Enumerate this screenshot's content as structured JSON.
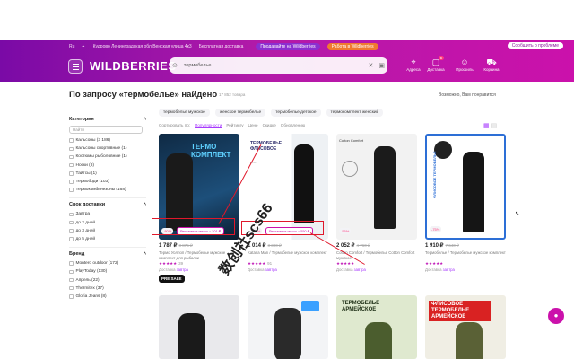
{
  "topbar": {
    "city": "Ru",
    "address": "Кудрово Ленинградская обл Венская улица 4к3",
    "free_delivery": "Бесплатная доставка",
    "sell_link": "Продавайте на Wildberries",
    "work_link": "Работа в Wildberries",
    "support": "Сообщить о проблеме"
  },
  "header": {
    "logo": "WILDBERRIES",
    "search_value": "термобелье",
    "nav": [
      {
        "label": "Адреса",
        "icon": "location-icon"
      },
      {
        "label": "Доставка",
        "icon": "box-icon",
        "badge": "6"
      },
      {
        "label": "Профиль",
        "icon": "user-icon"
      },
      {
        "label": "Корзина",
        "icon": "cart-icon"
      }
    ]
  },
  "page": {
    "title": "По запросу «термобелье» найдено",
    "count": "17 852 товара",
    "maybe_like": "Возможно, Вам понравится"
  },
  "chips": [
    "термобелье мужское",
    "женское термобелье",
    "термобелье детское",
    "термокомплект женский"
  ],
  "sort": {
    "options": [
      "Популярности",
      "Рейтингу",
      "Цене",
      "Скидке",
      "Обновлению"
    ],
    "label": "Сортировать по:"
  },
  "sidebar": {
    "category_title": "Категория",
    "search_placeholder": "Найти",
    "categories": [
      "Кальсоны (3 186)",
      "Кальсоны спортивные (1)",
      "Костюмы рыболовные (1)",
      "Носки (8)",
      "Тайтсы (1)",
      "Термободи (103)",
      "Термокомбинезоны (168)"
    ],
    "delivery_title": "Срок доставки",
    "delivery": [
      "Завтра",
      "до 2 дней",
      "до 3 дней",
      "до 5 дней"
    ],
    "brand_title": "Бренд",
    "brands": [
      "Montero outdoor (172)",
      "PlayToday (130)",
      "Апрель (22)",
      "Thermitex (37)",
      "Gloria Jeans (8)"
    ]
  },
  "products": [
    {
      "price": "1 787 ₽",
      "old": "8 875 ₽",
      "name": "Термо Уоллоп / Термобелье мужское комплект для рыбалки",
      "rating": "★★★★★",
      "reviews": "39",
      "delivery_label": "Доставка",
      "delivery_day": "завтра",
      "ad": "Рекламное место = 201 ₽",
      "img_title": "ТЕРМО КОМПЛЕКТ",
      "discount": "-80%",
      "presale": "PRE SALE"
    },
    {
      "price": "1 014 ₽",
      "old": "3 300 ₽",
      "name": "Katana Man / Термобелье мужское комплект",
      "rating": "★★★★★",
      "reviews": "91",
      "delivery_label": "Доставка",
      "delivery_day": "завтра",
      "ad": "Рекламное место = 550 ₽",
      "img_title": "ТЕРМОБЕЛЬЕ ФЛИСОВОЕ",
      "discount": "-70%"
    },
    {
      "price": "2 052 ₽",
      "old": "4 760 ₽",
      "name": "Cotton Comfort / Термобелье Cotton Comfort мужское",
      "rating": "★★★★★",
      "reviews": "",
      "delivery_label": "Доставка",
      "delivery_day": "завтра",
      "img_title": "Cotton Comfort",
      "discount": "-56%"
    },
    {
      "price": "1 910 ₽",
      "old": "7 640 ₽",
      "name": "Термобелье / Термобелье мужское комплект",
      "rating": "★★★★★",
      "reviews": "",
      "delivery_label": "Доставка",
      "delivery_day": "завтра",
      "img_title": "ФЛИСОВОЕ ТЕРМОБЕЛЬЕ",
      "discount": "-75%"
    }
  ],
  "row2": [
    {
      "title": ""
    },
    {
      "title": ""
    },
    {
      "title": "ТЕРМОБЕЛЬЕ АРМЕЙСКОЕ"
    },
    {
      "title": "ФЛИСОВОЕ ТЕРМОБЕЛЬЕ АРМЕЙСКОЕ"
    }
  ],
  "watermark": "数创社scs66",
  "colors": {
    "brand": "#cb11ab",
    "accent": "#a73afd",
    "annotation": "#e0182b"
  }
}
